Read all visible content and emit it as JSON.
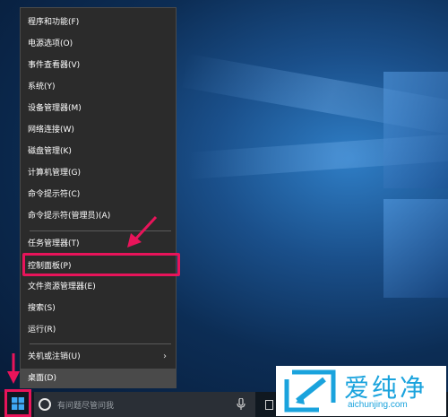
{
  "context_menu": {
    "items": [
      {
        "label": "程序和功能(F)"
      },
      {
        "label": "电源选项(O)"
      },
      {
        "label": "事件查看器(V)"
      },
      {
        "label": "系统(Y)"
      },
      {
        "label": "设备管理器(M)"
      },
      {
        "label": "网络连接(W)"
      },
      {
        "label": "磁盘管理(K)"
      },
      {
        "label": "计算机管理(G)"
      },
      {
        "label": "命令提示符(C)"
      },
      {
        "label": "命令提示符(管理员)(A)"
      },
      {
        "label": "任务管理器(T)"
      },
      {
        "label": "控制面板(P)"
      },
      {
        "label": "文件资源管理器(E)"
      },
      {
        "label": "搜索(S)"
      },
      {
        "label": "运行(R)"
      },
      {
        "label": "关机或注销(U)"
      },
      {
        "label": "桌面(D)"
      }
    ],
    "highlighted_item": "控制面板(P)"
  },
  "taskbar": {
    "search_placeholder": "有问题尽管问我"
  },
  "watermark": {
    "title": "爱纯净",
    "url": "aichunjing.com"
  },
  "colors": {
    "annotation": "#e8145a",
    "menu_bg": "#2b2b2b",
    "watermark": "#1aa3dd"
  }
}
